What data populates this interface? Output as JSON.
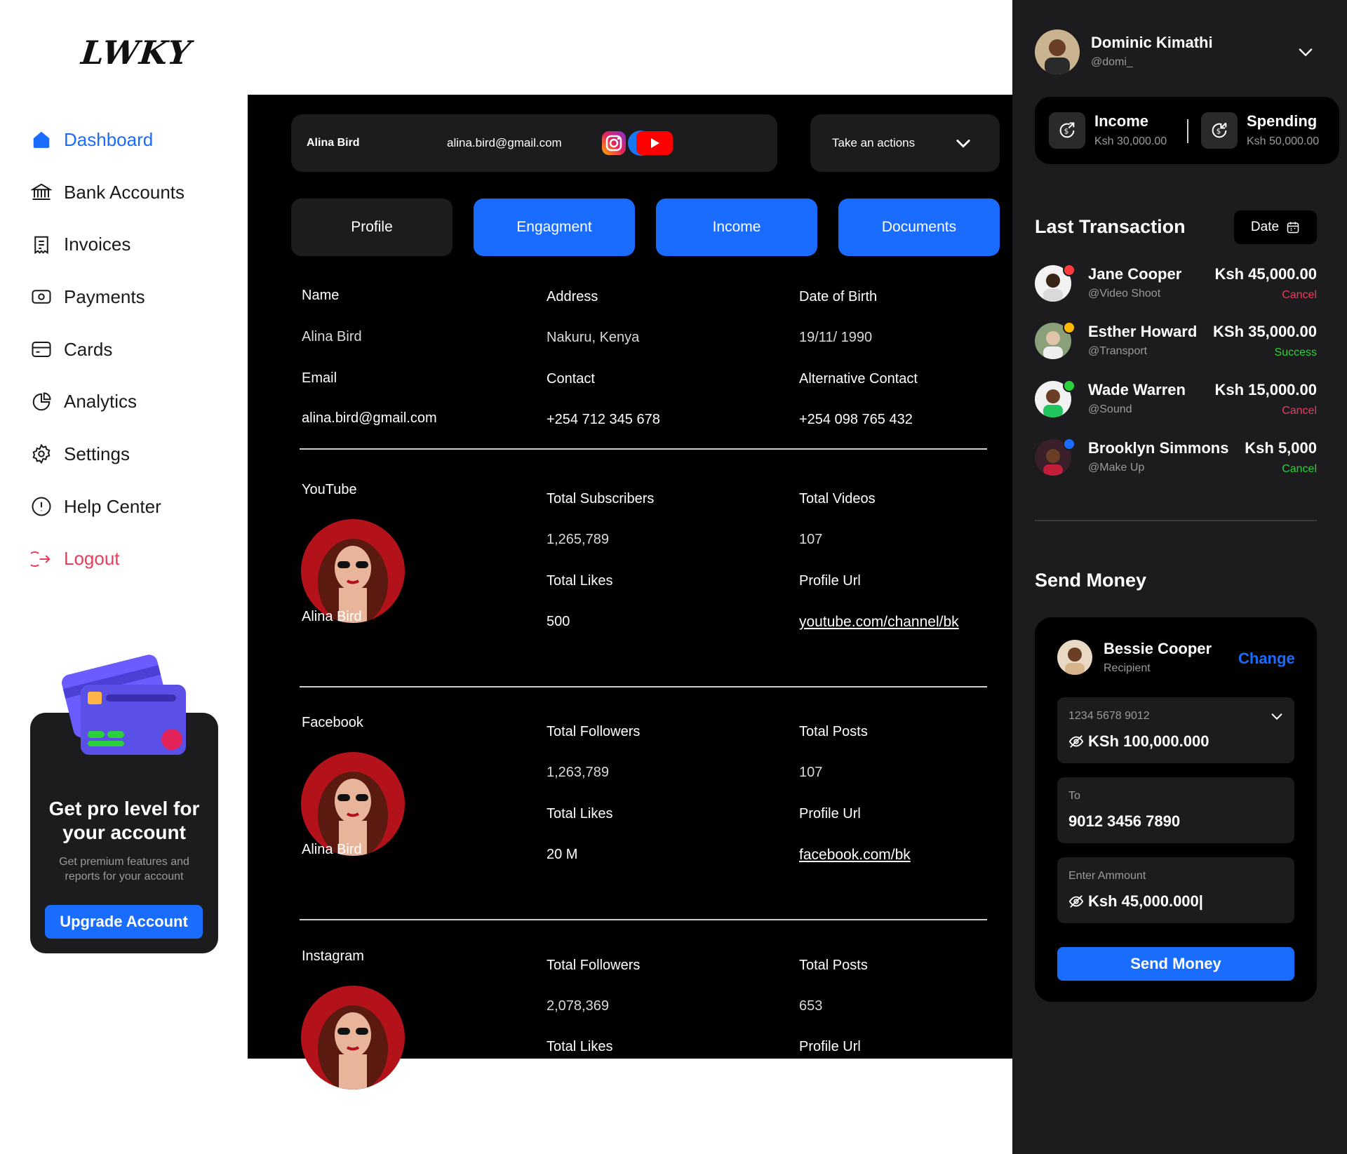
{
  "brand": {
    "logo": "LWKY"
  },
  "sidebar": {
    "items": [
      {
        "label": "Dashboard",
        "icon": "home-icon",
        "state": "active"
      },
      {
        "label": "Bank Accounts",
        "icon": "bank-icon",
        "state": "normal"
      },
      {
        "label": "Invoices",
        "icon": "invoice-icon",
        "state": "normal"
      },
      {
        "label": "Payments",
        "icon": "payments-icon",
        "state": "normal"
      },
      {
        "label": "Cards",
        "icon": "card-icon",
        "state": "normal"
      },
      {
        "label": "Analytics",
        "icon": "pie-chart-icon",
        "state": "normal"
      },
      {
        "label": "Settings",
        "icon": "gear-icon",
        "state": "normal"
      },
      {
        "label": "Help Center",
        "icon": "info-icon",
        "state": "normal"
      },
      {
        "label": "Logout",
        "icon": "logout-icon",
        "state": "danger"
      }
    ],
    "promo": {
      "title": "Get pro level for your account",
      "subtitle": "Get premium features and reports for your account",
      "button": "Upgrade Account"
    }
  },
  "main": {
    "topbar": {
      "name": "Alina Bird",
      "email": "alina.bird@gmail.com",
      "socials": [
        "facebook-icon",
        "instagram-icon",
        "youtube-icon"
      ],
      "actions_label": "Take an actions"
    },
    "tabs": [
      {
        "label": "Profile",
        "state": "selected-dark"
      },
      {
        "label": "Engagment",
        "state": "blue"
      },
      {
        "label": "Income",
        "state": "blue"
      },
      {
        "label": "Documents",
        "state": "blue"
      }
    ],
    "profile": {
      "name_label": "Name",
      "name": "Alina Bird",
      "address_label": "Address",
      "address": "Nakuru, Kenya",
      "dob_label": "Date of Birth",
      "dob": "19/11/ 1990",
      "email_label": "Email",
      "email": "alina.bird@gmail.com",
      "contact_label": "Contact",
      "contact": "+254 712 345 678",
      "alt_label": "Alternative Contact",
      "alt": "+254 098 765 432"
    },
    "youtube": {
      "platform": "YouTube",
      "owner": "Alina Bird",
      "stat1_label": "Total Subscribers",
      "stat1": "1,265,789",
      "stat2_label": "Total Videos",
      "stat2": "107",
      "stat3_label": "Total Likes",
      "stat3": "500",
      "url_label": "Profile Url",
      "url": "youtube.com/channel/bk"
    },
    "facebook": {
      "platform": "Facebook",
      "owner": "Alina Bird",
      "stat1_label": "Total  Followers",
      "stat1": "1,263,789",
      "stat2_label": "Total Posts",
      "stat2": "107",
      "stat3_label": "Total Likes",
      "stat3": "20 M",
      "url_label": "Profile Url",
      "url": "facebook.com/bk"
    },
    "instagram": {
      "platform": "Instagram",
      "stat1_label": "Total  Followers",
      "stat1": "2,078,369",
      "stat2_label": "Total Posts",
      "stat2": "653",
      "stat3_label": "Total Likes",
      "url_label": "Profile Url"
    }
  },
  "right": {
    "user": {
      "name": "Dominic Kimathi",
      "handle": "@domi_"
    },
    "income": {
      "label": "Income",
      "value": "Ksh 30,000.00"
    },
    "spending": {
      "label": "Spending",
      "value": "Ksh 50,000.00"
    },
    "last_transaction": {
      "title": "Last Transaction",
      "filter": "Date",
      "items": [
        {
          "name": "Jane Cooper",
          "category": "@Video Shoot",
          "amount": "Ksh 45,000.00",
          "status": "Cancel",
          "dot": "#ff3b3b"
        },
        {
          "name": "Esther Howard",
          "category": "@Transport",
          "amount": "KSh 35,000.00",
          "status": "Success",
          "dot": "#ffb800"
        },
        {
          "name": "Wade Warren",
          "category": "@Sound",
          "amount": "Ksh 15,000.00",
          "status": "Cancel",
          "dot": "#2bd13a"
        },
        {
          "name": "Brooklyn Simmons",
          "category": "@Make Up",
          "amount": "Ksh 5,000",
          "status": "Cancel",
          "dot": "#1a6cff"
        }
      ]
    },
    "send_money": {
      "title": "Send Money",
      "recipient_name": "Bessie Cooper",
      "recipient_role": "Recipient",
      "change": "Change",
      "from_account": "1234 5678 9012",
      "from_balance": "KSh 100,000.000",
      "to_label": "To",
      "to_account": "9012 3456 7890",
      "amount_label": "Enter Ammount",
      "amount": "Ksh 45,000.000|",
      "button": "Send Money"
    }
  },
  "colors": {
    "accent": "#1a6cff",
    "danger": "#ea3d5c",
    "success": "#2bd13a",
    "panel": "#1c1c1e"
  }
}
